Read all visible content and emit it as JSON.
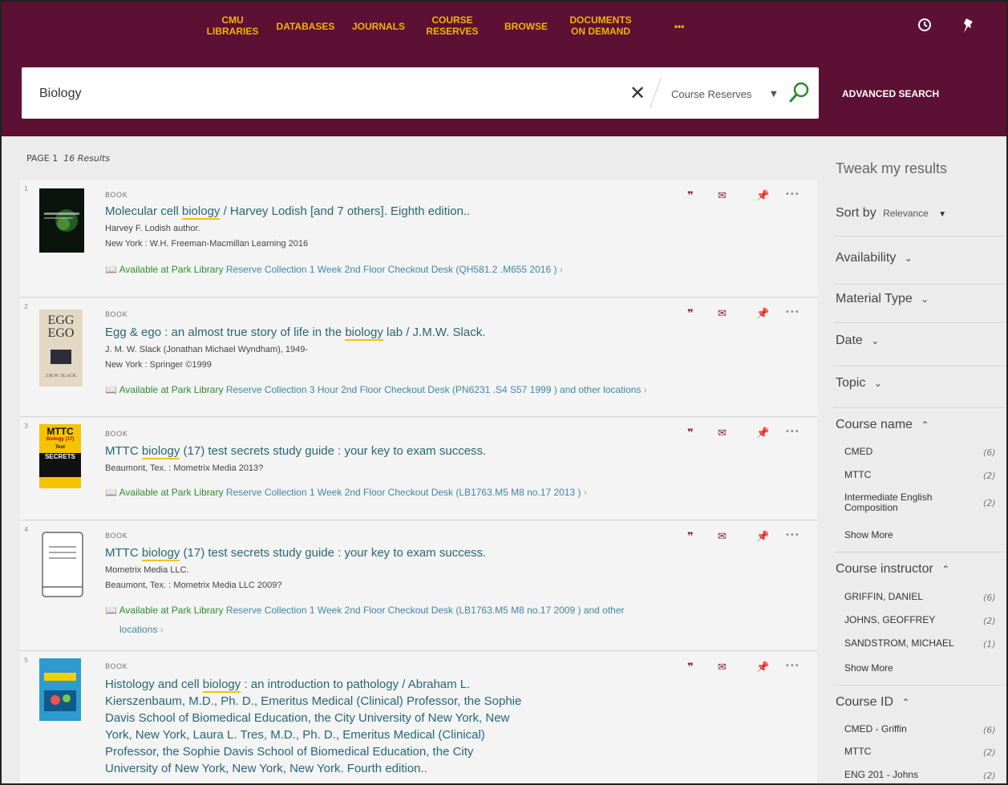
{
  "nav": {
    "items": [
      "CMU\nLIBRARIES",
      "DATABASES",
      "JOURNALS",
      "COURSE\nRESERVES",
      "BROWSE",
      "DOCUMENTS\nON DEMAND",
      "•••"
    ]
  },
  "search": {
    "query": "Biology",
    "clear_glyph": "✕",
    "scope": "Course Reserves",
    "advanced_label": "ADVANCED SEARCH"
  },
  "results_header": {
    "page": "PAGE 1",
    "count": "16 Results"
  },
  "results": [
    {
      "num": "1",
      "type": "BOOK",
      "title_before": "Molecular cell ",
      "title_hl": "biology",
      "title_after": " / Harvey Lodish [and 7 others]. Eighth edition..",
      "lines": [
        "Harvey F. Lodish author.",
        "New York : W.H. Freeman-Macmillan Learning 2016"
      ],
      "available": "Available at Park Library",
      "location": "Reserve Collection 1 Week 2nd Floor Checkout Desk (QH581.2 .M655 2016 )",
      "location_more": " "
    },
    {
      "num": "2",
      "type": "BOOK",
      "title_before": "Egg & ego : an almost true story of life in the ",
      "title_hl": "biology",
      "title_after": " lab / J.M.W. Slack.",
      "lines": [
        "J. M. W. Slack (Jonathan Michael Wyndham), 1949-",
        "New York : Springer ©1999"
      ],
      "available": "Available at Park Library",
      "location": "Reserve Collection 3 Hour 2nd Floor Checkout Desk (PN6231 .S4 S57 1999 ) and other locations",
      "location_more": ""
    },
    {
      "num": "3",
      "type": "BOOK",
      "title_before": "MTTC ",
      "title_hl": "biology",
      "title_after": " (17) test secrets study guide : your key to exam success.",
      "lines": [
        "Beaumont, Tex. : Mometrix Media 2013?"
      ],
      "available": "Available at Park Library",
      "location": "Reserve Collection 1 Week 2nd Floor Checkout Desk (LB1763.M5 M8 no.17 2013 )",
      "location_more": ""
    },
    {
      "num": "4",
      "type": "BOOK",
      "title_before": "MTTC ",
      "title_hl": "biology",
      "title_after": " (17) test secrets study guide : your key to exam success.",
      "lines": [
        "Mometrix Media LLC.",
        "Beaumont, Tex. : Mometrix Media LLC 2009?"
      ],
      "available": "Available at Park Library",
      "location": "Reserve Collection 1 Week 2nd Floor Checkout Desk (LB1763.M5 M8 no.17 2009 ) and other",
      "location_more": "locations"
    },
    {
      "num": "5",
      "type": "BOOK",
      "title_before": "Histology and cell ",
      "title_hl": "biology",
      "title_after": " : an introduction to pathology / Abraham L.",
      "title_cont": [
        "Kierszenbaum, M.D., Ph. D., Emeritus Medical (Clinical) Professor, the Sophie",
        "Davis School of Biomedical Education, the City University of New York, New",
        "York, New York, Laura L. Tres, M.D., Ph. D., Emeritus Medical (Clinical)",
        "Professor, the Sophie Davis School of Biomedical Education, the City",
        "University of New York, New York, New York. Fourth edition.."
      ]
    }
  ],
  "thumbs": {
    "t2_l1": "EGG",
    "t2_l2": "EGO",
    "t2_author": "J.M.W. SLACK",
    "t3_l1": "MTTC",
    "t3_l2": "Biology (17)",
    "t3_l3": "Test",
    "t3_l4": "SECRETS"
  },
  "sidebar": {
    "title": "Tweak my results",
    "sort_label": "Sort by",
    "sort_value": "Relevance",
    "facets": [
      "Availability",
      "Material Type",
      "Date",
      "Topic"
    ],
    "course_name": {
      "title": "Course name",
      "items": [
        {
          "label": "CMED",
          "count": "(6)"
        },
        {
          "label": "MTTC",
          "count": "(2)"
        },
        {
          "label": "Intermediate English\nComposition",
          "count": "(2)"
        }
      ],
      "more": "Show More"
    },
    "course_instructor": {
      "title": "Course instructor",
      "items": [
        {
          "label": "GRIFFIN, DANIEL",
          "count": "(6)"
        },
        {
          "label": "JOHNS, GEOFFREY",
          "count": "(2)"
        },
        {
          "label": "SANDSTROM, MICHAEL",
          "count": "(1)"
        }
      ],
      "more": "Show More"
    },
    "course_id": {
      "title": "Course ID",
      "items": [
        {
          "label": "CMED - Griffin",
          "count": "(6)"
        },
        {
          "label": "MTTC",
          "count": "(2)"
        },
        {
          "label": "ENG 201 - Johns",
          "count": "(2)"
        }
      ]
    }
  },
  "colors": {
    "brand": "#5c1033",
    "accent": "#f3b400",
    "link": "#276678",
    "available": "#2e8c2e"
  }
}
